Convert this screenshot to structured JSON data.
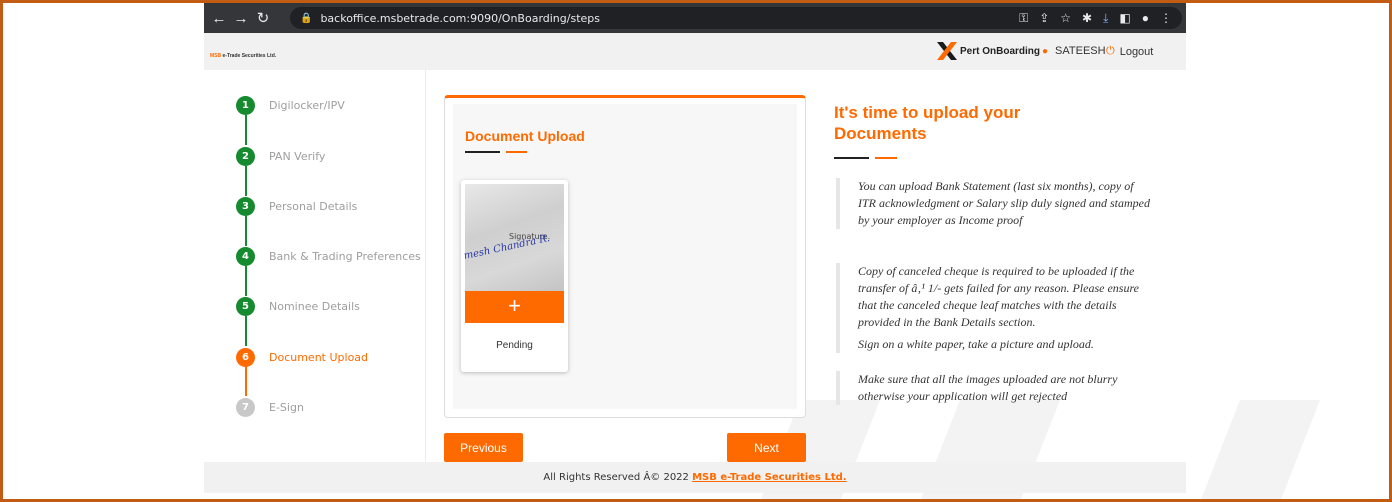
{
  "browser": {
    "url": "backoffice.msbetrade.com:9090/OnBoarding/steps",
    "icons": [
      "back-icon",
      "forward-icon",
      "reload-icon",
      "lock-icon"
    ]
  },
  "header": {
    "brand": "e-Trade Securities Ltd.",
    "product": "Pert OnBoarding",
    "user": "SATEESH",
    "logout": "Logout"
  },
  "steps": [
    {
      "num": "1",
      "label": "Digilocker/IPV",
      "state": "done"
    },
    {
      "num": "2",
      "label": "PAN Verify",
      "state": "done"
    },
    {
      "num": "3",
      "label": "Personal Details",
      "state": "done"
    },
    {
      "num": "4",
      "label": "Bank & Trading Preferences",
      "state": "done"
    },
    {
      "num": "5",
      "label": "Nominee Details",
      "state": "done"
    },
    {
      "num": "6",
      "label": "Document Upload",
      "state": "active"
    },
    {
      "num": "7",
      "label": "E-Sign",
      "state": "todo"
    }
  ],
  "card": {
    "title": "Document Upload",
    "doc": {
      "image_text": "Signature.",
      "handwriting": "mesh Chandra R.",
      "add": "+",
      "status": "Pending"
    }
  },
  "buttons": {
    "previous": "Previous",
    "next": "Next"
  },
  "info": {
    "title": "It's time to upload your Documents",
    "notes": [
      "You can upload Bank Statement (last six months), copy of ITR acknowledgment or Salary slip duly signed and stamped by your employer as Income proof",
      "Copy of canceled cheque is required to be uploaded if the transfer of â‚¹ 1/- gets failed for any reason. Please ensure that the canceled cheque leaf matches with the details provided in the Bank Details section.",
      "Sign on a white paper, take a picture and upload.",
      "Make sure that all the images uploaded are not blurry otherwise your application will get rejected"
    ]
  },
  "footer": {
    "text": "All Rights Reserved Â© 2022 ",
    "link": "MSB e-Trade Securities Ltd."
  },
  "colors": {
    "accent": "#ff6a00",
    "done": "#168a2f",
    "todo": "#c8c8c8"
  }
}
